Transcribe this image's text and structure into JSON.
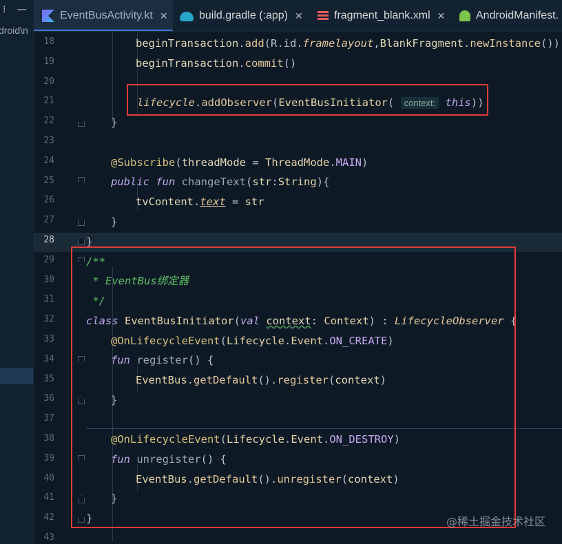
{
  "sidebar": {
    "icons": "⁝ —",
    "path_text": "droid\\n"
  },
  "tabs": [
    {
      "label": "EventBusActivity.kt",
      "icon": "kotlin-file-icon",
      "active": true
    },
    {
      "label": "build.gradle (:app)",
      "icon": "gradle-icon",
      "active": false
    },
    {
      "label": "fragment_blank.xml",
      "icon": "xml-layout-icon",
      "active": false
    },
    {
      "label": "AndroidManifest.",
      "icon": "android-manifest-icon",
      "active": false
    }
  ],
  "editor": {
    "current_line": "28",
    "lines": [
      {
        "n": "18"
      },
      {
        "n": "19"
      },
      {
        "n": "20"
      },
      {
        "n": "21"
      },
      {
        "n": "22"
      },
      {
        "n": "23"
      },
      {
        "n": "24"
      },
      {
        "n": "25"
      },
      {
        "n": "26"
      },
      {
        "n": "27"
      },
      {
        "n": "28"
      },
      {
        "n": "29"
      },
      {
        "n": "30"
      },
      {
        "n": "31"
      },
      {
        "n": "32"
      },
      {
        "n": "33"
      },
      {
        "n": "34"
      },
      {
        "n": "35"
      },
      {
        "n": "36"
      },
      {
        "n": "37"
      },
      {
        "n": "38"
      },
      {
        "n": "39"
      },
      {
        "n": "40"
      },
      {
        "n": "41"
      },
      {
        "n": "42"
      },
      {
        "n": "43"
      }
    ],
    "code": {
      "l18": {
        "a": "beginTransaction",
        "b": ".",
        "c": "add",
        "d": "(R.id.",
        "e": "framelayout",
        "f": ",",
        "g": "BlankFragment",
        "h": ".",
        "i": "newInstance",
        "j": "())"
      },
      "l19": {
        "a": "beginTransaction",
        "b": ".",
        "c": "commit",
        "d": "()"
      },
      "l21": {
        "a": "lifecycle",
        "b": ".",
        "c": "addObserver",
        "d": "(",
        "e": "EventBusInitiator",
        "f": "(",
        "hint": "context:",
        "g": "this",
        "h": "))"
      },
      "l22": "}",
      "l24": {
        "a": "@Subscribe",
        "b": "(",
        "c": "threadMode",
        "d": " = ",
        "e": "ThreadMode",
        "f": ".",
        "g": "MAIN",
        "h": ")"
      },
      "l25": {
        "a": "public",
        "b": " ",
        "c": "fun",
        "d": " changeText",
        "e": "(",
        "f": "str",
        "g": ":",
        "h": "String",
        "i": "){"
      },
      "l26": {
        "a": "tvContent",
        "b": ".",
        "c": "text",
        "d": " = ",
        "e": "str"
      },
      "l27": "}",
      "l28": "}",
      "l29": "/**",
      "l30": " * EventBus绑定器",
      "l31": " */",
      "l32": {
        "a": "class",
        "b": " EventBusInitiator",
        "c": "(",
        "d": "val",
        "e": " ",
        "f": "context",
        "g": ": ",
        "h": "Context",
        "i": ") : ",
        "j": "LifecycleObserver",
        "k": " {"
      },
      "l33": {
        "a": "@OnLifecycleEvent",
        "b": "(",
        "c": "Lifecycle",
        "d": ".",
        "e": "Event",
        "f": ".",
        "g": "ON_CREATE",
        "h": ")"
      },
      "l34": {
        "a": "fun",
        "b": " register",
        "c": "() {"
      },
      "l35": {
        "a": "EventBus",
        "b": ".",
        "c": "getDefault",
        "d": "().",
        "e": "register",
        "f": "(",
        "g": "context",
        "h": ")"
      },
      "l36": "}",
      "l38": {
        "a": "@OnLifecycleEvent",
        "b": "(",
        "c": "Lifecycle",
        "d": ".",
        "e": "Event",
        "f": ".",
        "g": "ON_DESTROY",
        "h": ")"
      },
      "l39": {
        "a": "fun",
        "b": " unregister",
        "c": "() {"
      },
      "l40": {
        "a": "EventBus",
        "b": ".",
        "c": "getDefault",
        "d": "().",
        "e": "unregister",
        "f": "(",
        "g": "context",
        "h": ")"
      },
      "l41": "}",
      "l42": "}"
    }
  },
  "watermark": "@稀土掘金技术社区",
  "colors": {
    "background": "#0d1a26",
    "highlight_box": "#e33b3b",
    "active_tab_underline": "#3d7bd9"
  }
}
